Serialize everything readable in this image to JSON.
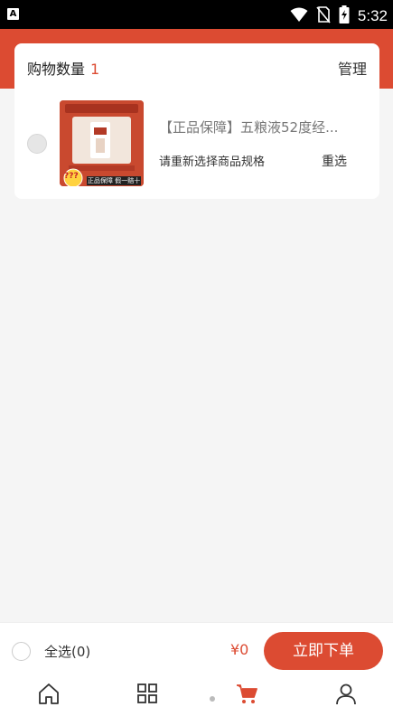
{
  "status_bar": {
    "app_badge": "A",
    "time": "5:32",
    "icons": [
      "wifi-icon",
      "no-sim-icon",
      "battery-charging-icon"
    ]
  },
  "cart": {
    "count_label": "购物数量",
    "count_value": "1",
    "manage_label": "管理"
  },
  "item": {
    "title": "【正品保障】五粮液52度经...",
    "spec_prompt": "请重新选择商品规格",
    "reselect_label": "重选",
    "thumb_badge": "???",
    "thumb_caption": "正品保障 假一赔十"
  },
  "bottom_bar": {
    "select_all_label": "全选(0)",
    "total": "¥0",
    "order_button": "立即下单"
  },
  "tab_bar": {
    "tabs": [
      "home-icon",
      "category-icon",
      "cart-icon",
      "profile-icon"
    ],
    "active": "cart-icon",
    "active_color": "#dc4b32"
  },
  "colors": {
    "accent": "#dc4b32",
    "background": "#f5f5f5"
  }
}
